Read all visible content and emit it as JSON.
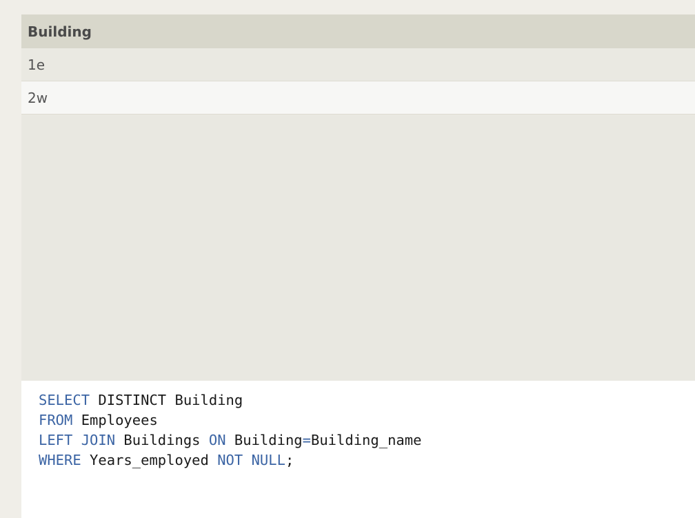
{
  "results_table": {
    "columns": [
      "Building"
    ],
    "rows": [
      [
        "1e"
      ],
      [
        "2w"
      ]
    ]
  },
  "query_editor": {
    "lines": [
      [
        {
          "t": "SELECT",
          "kind": "kw"
        },
        {
          "t": " DISTINCT Building",
          "kind": "plain"
        }
      ],
      [
        {
          "t": "FROM",
          "kind": "kw"
        },
        {
          "t": " Employees",
          "kind": "plain"
        }
      ],
      [
        {
          "t": "LEFT JOIN",
          "kind": "kw"
        },
        {
          "t": " Buildings ",
          "kind": "plain"
        },
        {
          "t": "ON",
          "kind": "kw"
        },
        {
          "t": " Building",
          "kind": "plain"
        },
        {
          "t": "=",
          "kind": "kw"
        },
        {
          "t": "Building_name",
          "kind": "plain"
        }
      ],
      [
        {
          "t": "WHERE",
          "kind": "kw"
        },
        {
          "t": " Years_employed ",
          "kind": "plain"
        },
        {
          "t": "NOT NULL",
          "kind": "kw"
        },
        {
          "t": ";",
          "kind": "plain"
        }
      ]
    ]
  },
  "colors": {
    "keyword": "#3b64a4",
    "header_bg": "#d8d7cb",
    "panel_bg": "#e9e8e1",
    "editor_bg": "#ffffff"
  }
}
